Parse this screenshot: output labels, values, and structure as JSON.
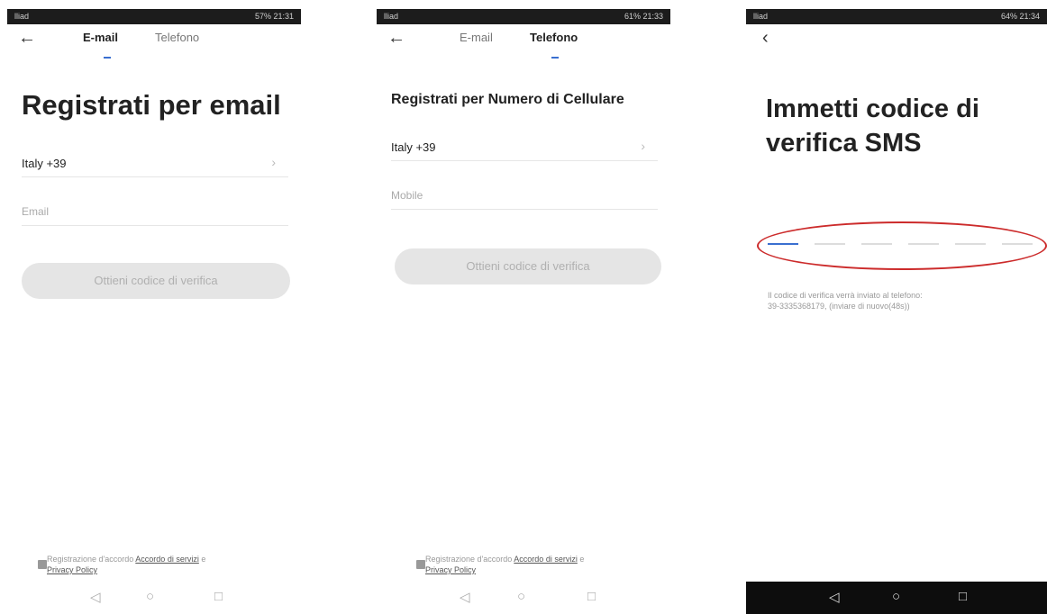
{
  "screen1": {
    "status_left": "lliad",
    "status_right": "57% 21:31",
    "back_icon": "arrow-left",
    "tab_email": "E-mail",
    "tab_phone": "Telefono",
    "title": "Registrati per email",
    "country": "Italy +39",
    "email_placeholder": "Email",
    "button": "Ottieni codice di verifica",
    "terms_text": "Registrazione d'accordo",
    "terms_link1": "Accordo di servizi",
    "terms_and": "e",
    "terms_link2": "Privacy Policy"
  },
  "screen2": {
    "status_left": "lliad",
    "status_right": "61% 21:33",
    "back_icon": "arrow-left",
    "tab_email": "E-mail",
    "tab_phone": "Telefono",
    "title": "Registrati per Numero di Cellulare",
    "country": "Italy +39",
    "mobile_placeholder": "Mobile",
    "button": "Ottieni codice di verifica",
    "terms_text": "Registrazione d'accordo",
    "terms_link1": "Accordo di servizi",
    "terms_and": "e",
    "terms_link2": "Privacy Policy"
  },
  "screen3": {
    "status_left": "lliad",
    "status_right": "64% 21:34",
    "back_icon": "chevron-left",
    "title_line1": "Immetti codice di",
    "title_line2": "verifica SMS",
    "hint_line1": "Il codice di verifica verrà inviato al telefono:",
    "hint_line2": "39-3335368179, (inviare di nuovo(48s))",
    "annotation_color": "#cc2b2b"
  },
  "nav": {
    "back_glyph": "◁",
    "home_glyph": "○",
    "recent_glyph": "□"
  },
  "colors": {
    "accent": "#3a6fd0",
    "button_disabled": "#e5e5e5"
  }
}
